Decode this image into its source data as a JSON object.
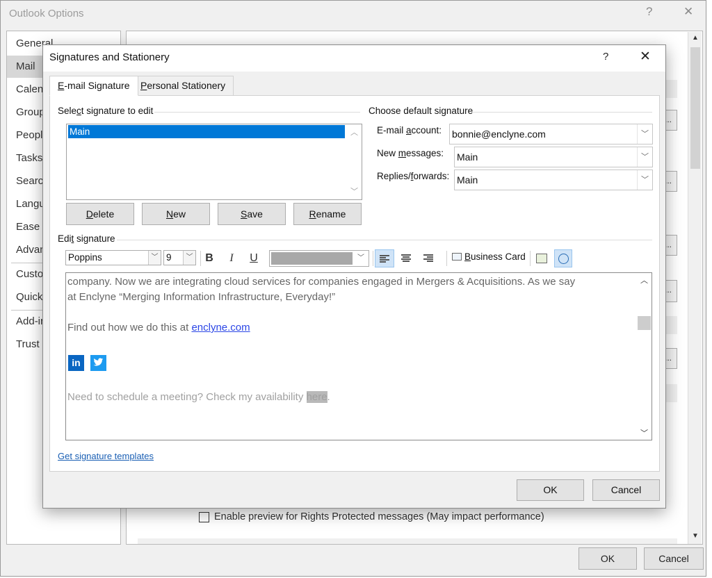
{
  "outer": {
    "title": "Outlook Options",
    "help": "?",
    "close": "✕",
    "nav": [
      "General",
      "Mail",
      "Calendar",
      "Groups",
      "People",
      "Tasks",
      "Search",
      "Language",
      "Ease of Access",
      "Advanced",
      "Customize Ribbon",
      "Quick Access Toolbar",
      "Add-ins",
      "Trust Center"
    ],
    "selected_nav": "Mail",
    "preview_checkbox_label": "Enable preview for Rights Protected messages (May impact performance)",
    "ok": "OK",
    "cancel": "Cancel",
    "ellipsis": "..."
  },
  "dialog": {
    "title": "Signatures and Stationery",
    "help": "?",
    "close": "✕",
    "tabs": {
      "email_signature": {
        "accel": "E",
        "rest": "-mail Signature"
      },
      "personal_stationery": {
        "accel": "P",
        "rest": "ersonal Stationery"
      }
    },
    "select_signature_label": {
      "pre": "Sele",
      "accel": "c",
      "post": "t signature to edit"
    },
    "signatures": [
      "Main"
    ],
    "buttons": {
      "delete": {
        "accel": "D",
        "rest": "elete"
      },
      "new": {
        "accel": "N",
        "rest": "ew"
      },
      "save": {
        "accel": "S",
        "rest": "ave"
      },
      "rename": {
        "accel": "R",
        "rest": "ename"
      }
    },
    "choose_default_label": "Choose default signature",
    "email_account": {
      "pre": "E-mail ",
      "accel": "a",
      "post": "ccount:",
      "value": "bonnie@enclyne.com"
    },
    "new_messages": {
      "pre": "New ",
      "accel": "m",
      "post": "essages:",
      "value": "Main"
    },
    "replies_forwards": {
      "pre": "Replies/",
      "accel": "f",
      "post": "orwards:",
      "value": "Main"
    },
    "edit_signature_label": {
      "pre": "Edi",
      "accel": "t",
      "post": " signature"
    },
    "toolbar": {
      "font": "Poppins",
      "size": "9",
      "bold": "B",
      "italic": "I",
      "underline": "U",
      "business_card": {
        "accel": "B",
        "rest": "usiness Card"
      }
    },
    "editor": {
      "line1": "company.  Now we are integrating cloud services for companies engaged in Mergers & Acquisitions.   As we say",
      "line2": "at Enclyne “Merging Information Infrastructure, Everyday!”",
      "line3_pre": "Find out how we do this at ",
      "line3_link": "enclyne.com",
      "line4_pre": "Need to schedule a meeting? Check my availability ",
      "line4_link": "here",
      "line4_post": ".",
      "linkedin": "in"
    },
    "templates_link": "Get signature templates",
    "ok": "OK",
    "cancel": "Cancel"
  }
}
